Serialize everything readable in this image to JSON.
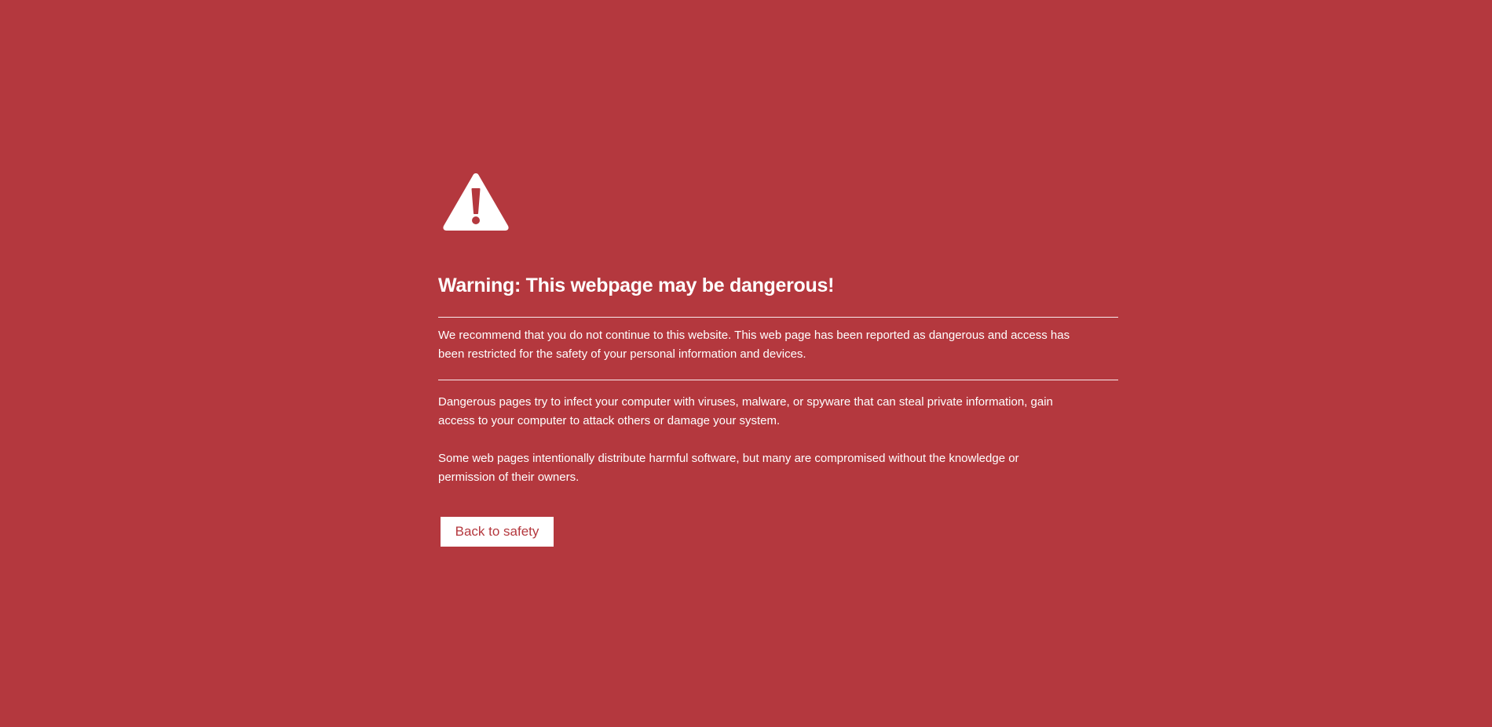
{
  "warning": {
    "icon": "warning-triangle-icon",
    "title": "Warning: This webpage may be dangerous!",
    "recommendation": "We recommend that you do not continue to this website. This web page has been reported as dangerous and access has been restricted for the safety of your personal information and devices.",
    "explanation": "Dangerous pages try to infect your computer with viruses, malware, or spyware that can steal private information, gain access to your computer to attack others or damage your system.",
    "note": "Some web pages intentionally distribute harmful software, but many are compromised without the knowledge or permission of their owners.",
    "back_button_label": "Back to safety"
  },
  "colors": {
    "background": "#b4383e",
    "text": "#ffffff",
    "button_background": "#ffffff",
    "button_text": "#b4383e"
  }
}
